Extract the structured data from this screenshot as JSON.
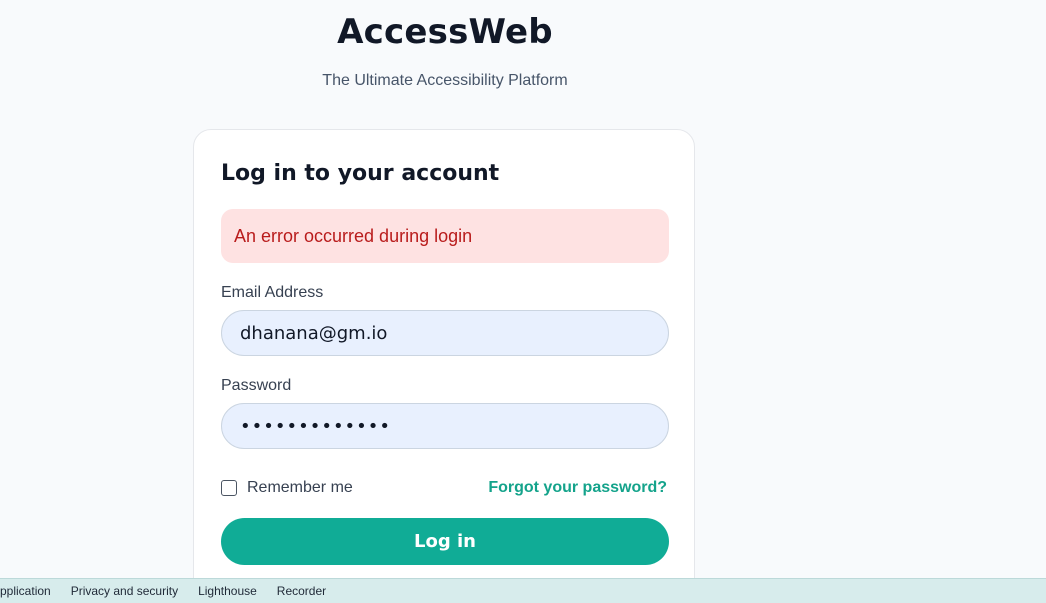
{
  "brand": {
    "title": "AccessWeb",
    "subtitle": "The Ultimate Accessibility Platform"
  },
  "login_card": {
    "title": "Log in to your account",
    "error_message": "An error occurred during login",
    "email": {
      "label": "Email Address",
      "value": "dhanana@gm.io"
    },
    "password": {
      "label": "Password",
      "masked_value": "•••••••••••••"
    },
    "remember_me": {
      "label": "Remember me",
      "checked": false
    },
    "forgot_password_link": "Forgot your password?",
    "submit_label": "Log in"
  },
  "devtools": {
    "tabs": [
      "pplication",
      "Privacy and security",
      "Lighthouse",
      "Recorder"
    ]
  },
  "colors": {
    "accent": "#10ac96",
    "link": "#14a38b",
    "error_bg": "#fee2e2",
    "error_text": "#b91c1c",
    "input_bg": "#e8f0fe",
    "devtools_bg": "#d7ecec"
  }
}
